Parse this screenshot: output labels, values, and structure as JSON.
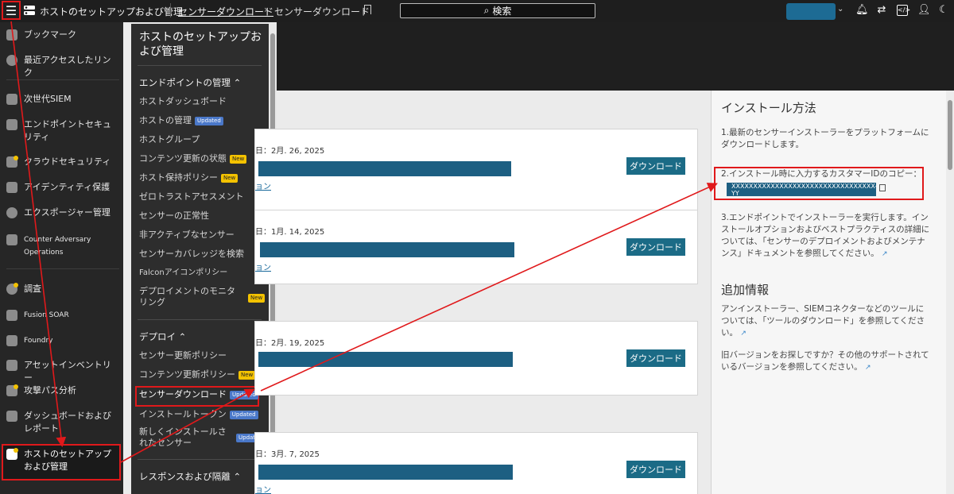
{
  "topbar": {
    "app_title": "ホストのセットアップおよび管理",
    "breadcrumb_link": "センサーダウンロード",
    "breadcrumb_current": "センサーダウンロード",
    "search_label": "検索"
  },
  "leftnav": {
    "items": [
      {
        "label": "ブックマーク",
        "icon": "bookmark-icon"
      },
      {
        "label": "最近アクセスしたリンク",
        "icon": "recent-icon"
      },
      {
        "label": "次世代SIEM",
        "icon": "siem-icon"
      },
      {
        "label": "エンドポイントセキュリティ",
        "icon": "endpoint-icon"
      },
      {
        "label": "クラウドセキュリティ",
        "icon": "cloud-icon"
      },
      {
        "label": "アイデンティティ保護",
        "icon": "identity-icon"
      },
      {
        "label": "エクスポージャー管理",
        "icon": "exposure-icon"
      },
      {
        "label": "Counter Adversary Operations",
        "icon": "adversary-icon"
      },
      {
        "label": "調査",
        "icon": "investigate-icon"
      },
      {
        "label": "Fusion SOAR",
        "icon": "fusion-icon"
      },
      {
        "label": "Foundry",
        "icon": "foundry-icon"
      },
      {
        "label": "アセットインベントリー",
        "icon": "asset-icon"
      },
      {
        "label": "攻撃パス分析",
        "icon": "attack-path-icon"
      },
      {
        "label": "ダッシュボードおよびレポート",
        "icon": "dashboard-icon"
      },
      {
        "label": "ホストのセットアップおよび管理",
        "icon": "host-setup-icon"
      }
    ]
  },
  "subnav": {
    "title": "ホストのセットアップおよび管理",
    "section1": "エンドポイントの管理",
    "section1_items": [
      {
        "label": "ホストダッシュボード",
        "badge": ""
      },
      {
        "label": "ホストの管理",
        "badge": "Updated"
      },
      {
        "label": "ホストグループ",
        "badge": ""
      },
      {
        "label": "コンテンツ更新の状態",
        "badge": "New"
      },
      {
        "label": "ホスト保持ポリシー",
        "badge": "New"
      },
      {
        "label": "ゼロトラストアセスメント",
        "badge": ""
      },
      {
        "label": "センサーの正常性",
        "badge": ""
      },
      {
        "label": "非アクティブなセンサー",
        "badge": ""
      },
      {
        "label": "センサーカバレッジを検索",
        "badge": ""
      },
      {
        "label": "Falconアイコンポリシー",
        "badge": ""
      },
      {
        "label": "デプロイメントのモニタリング",
        "badge": "New"
      }
    ],
    "section2": "デプロイ",
    "section2_items": [
      {
        "label": "センサー更新ポリシー",
        "badge": ""
      },
      {
        "label": "コンテンツ更新ポリシー",
        "badge": "New"
      },
      {
        "label": "センサーダウンロード",
        "badge": "Updated"
      },
      {
        "label": "インストールトークン",
        "badge": "Updated"
      },
      {
        "label": "新しくインストールされたセンサー",
        "badge": "Updated"
      }
    ],
    "section3": "レスポンスおよび隔離"
  },
  "releases": [
    {
      "date": "日：2月. 26, 2025",
      "link": "ョン",
      "button": "ダウンロード"
    },
    {
      "date": "日：1月. 14, 2025",
      "link": "ョン",
      "button": "ダウンロード"
    },
    {
      "date": "日：2月. 19, 2025",
      "link": "",
      "button": "ダウンロード"
    },
    {
      "date": "日：3月. 7, 2025",
      "link": "ョン",
      "button": "ダウンロード"
    }
  ],
  "install": {
    "title": "インストール方法",
    "step1": "1.最新のセンサーインストーラーをプラットフォームにダウンロードします。",
    "step2": "2.インストール時に入力するカスタマーIDのコピー：",
    "customer_id": "XXXXXXXXXXXXXXXXXXXXXXXXXXXXXXXXX-YY",
    "step3": "3.エンドポイントでインストーラーを実行します。インストールオプションおよびベストプラクティスの詳細については、「センサーのデプロイメントおよびメンテナンス」ドキュメントを参照してください。"
  },
  "more_info": {
    "title": "追加情報",
    "p1": "アンインストーラー、SIEMコネクターなどのツールについては、「ツールのダウンロード」を参照してください。",
    "p2": "旧バージョンをお探しですか？その他のサポートされているバージョンを参照してください。"
  },
  "colors": {
    "accent": "#1b6b86",
    "highlight": "#e0191b",
    "new_badge": "#f3c200",
    "updated_badge": "#4a78c9"
  }
}
